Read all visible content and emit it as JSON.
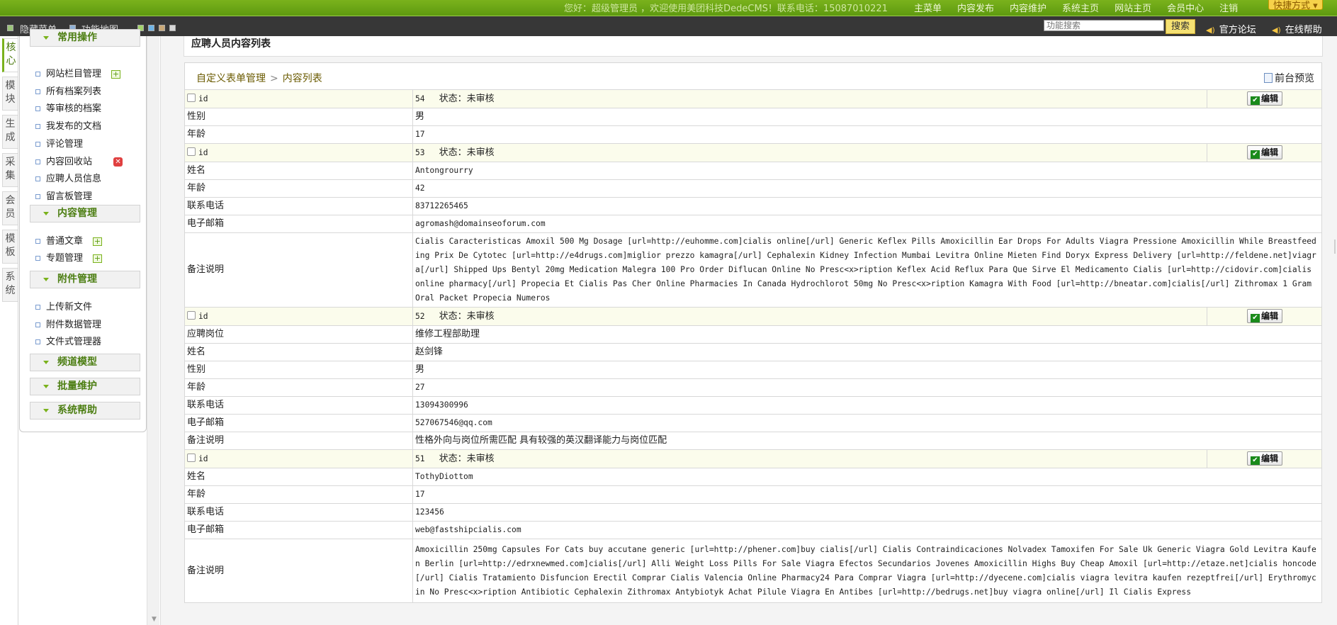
{
  "topbar": {
    "welcome": "您好：超级管理员 ，欢迎使用美团科技DedeCMS！联系电话：15087010221",
    "nav": [
      "主菜单",
      "内容发布",
      "内容维护",
      "系统主页",
      "网站主页",
      "会员中心",
      "注销"
    ],
    "quick": "快捷方式"
  },
  "toolbar": {
    "hide_menu": "隐藏菜单",
    "func_map": "功能地图",
    "search_placeholder": "功能搜索",
    "search_btn": "搜索",
    "forum": "官方论坛",
    "help": "在线帮助"
  },
  "left_tabs": [
    "核心",
    "模块",
    "生成",
    "采集",
    "会员",
    "模板",
    "系统"
  ],
  "menu": {
    "groups": [
      {
        "title": "常用操作",
        "items": [
          "网站栏目管理",
          "所有档案列表",
          "等审核的档案",
          "我发布的文档",
          "评论管理",
          "内容回收站",
          "应聘人员信息",
          "留言板管理"
        ]
      },
      {
        "title": "内容管理",
        "items": [
          "普通文章",
          "专题管理"
        ]
      },
      {
        "title": "附件管理",
        "items": [
          "上传新文件",
          "附件数据管理",
          "文件式管理器"
        ]
      },
      {
        "title": "频道模型",
        "items": []
      },
      {
        "title": "批量维护",
        "items": []
      },
      {
        "title": "系统帮助",
        "items": []
      }
    ]
  },
  "page": {
    "title": "应聘人员内容列表",
    "breadcrumb": [
      "自定义表单管理",
      "内容列表"
    ],
    "preview": "前台预览",
    "edit_label": "编辑",
    "id_label": "id",
    "status_label": "状态：",
    "status_value": "未审核"
  },
  "records": [
    {
      "id": "54",
      "fields": [
        {
          "label": "性别",
          "value": "男",
          "type": "cn"
        },
        {
          "label": "年龄",
          "value": "17",
          "type": "mono"
        }
      ]
    },
    {
      "id": "53",
      "fields": [
        {
          "label": "姓名",
          "value": "Antongrourry",
          "type": "mono"
        },
        {
          "label": "年龄",
          "value": "42",
          "type": "mono"
        },
        {
          "label": "联系电话",
          "value": "83712265465",
          "type": "mono"
        },
        {
          "label": "电子邮箱",
          "value": "agromash@domainseoforum.com",
          "type": "mono"
        },
        {
          "label": "备注说明",
          "value": "Cialis Caracteristicas Amoxil 500 Mg Dosage [url=http://euhomme.com]cialis online[/url] Generic Keflex Pills Amoxicillin Ear Drops For Adults Viagra Pressione Amoxicillin While Breastfeeding Prix De Cytotec [url=http://e4drugs.com]miglior prezzo kamagra[/url] Cephalexin Kidney Infection Mumbai Levitra Online Mieten Find Doryx Express Delivery [url=http://feldene.net]viagra[/url] Shipped Ups Bentyl 20mg Medication Malegra 100 Pro Order Diflucan Online No Presc<x>ription Keflex Acid Reflux Para Que Sirve El Medicamento Cialis [url=http://cidovir.com]cialis online pharmacy[/url] Propecia Et Cialis Pas Cher Online Pharmacies In Canada Hydrochlorot 50mg No Presc<x>ription Kamagra With Food [url=http://bneatar.com]cialis[/url] Zithromax 1 Gram Oral Packet Propecia Numeros",
          "type": "long"
        }
      ]
    },
    {
      "id": "52",
      "fields": [
        {
          "label": "应聘岗位",
          "value": "维修工程部助理",
          "type": "cn"
        },
        {
          "label": "姓名",
          "value": "赵剑锋",
          "type": "cn"
        },
        {
          "label": "性别",
          "value": "男",
          "type": "cn"
        },
        {
          "label": "年龄",
          "value": "27",
          "type": "mono"
        },
        {
          "label": "联系电话",
          "value": "13094300996",
          "type": "mono"
        },
        {
          "label": "电子邮箱",
          "value": "527067546@qq.com",
          "type": "mono"
        },
        {
          "label": "备注说明",
          "value": "性格外向与岗位所需匹配 具有较强的英汉翻译能力与岗位匹配",
          "type": "cn"
        }
      ]
    },
    {
      "id": "51",
      "fields": [
        {
          "label": "姓名",
          "value": "TothyDiottom",
          "type": "mono"
        },
        {
          "label": "年龄",
          "value": "17",
          "type": "mono"
        },
        {
          "label": "联系电话",
          "value": "123456",
          "type": "mono"
        },
        {
          "label": "电子邮箱",
          "value": "web@fastshipcialis.com",
          "type": "mono"
        },
        {
          "label": "备注说明",
          "value": "Amoxicillin 250mg Capsules For Cats buy accutane generic [url=http://phener.com]buy cialis[/url] Cialis Contraindicaciones Nolvadex Tamoxifen For Sale Uk Generic Viagra Gold Levitra Kaufen Berlin [url=http://edrxnewmed.com]cialis[/url] Alli Weight Loss Pills For Sale Viagra Efectos Secundarios Jovenes Amoxicillin Highs Buy Cheap Amoxil [url=http://etaze.net]cialis honcode[/url] Cialis Tratamiento Disfuncion Erectil Comprar Cialis Valencia Online Pharmacy24 Para Comprar Viagra [url=http://dyecene.com]cialis viagra levitra kaufen rezeptfrei[/url] Erythromycin No Presc<x>ription Antibiotic Cephalexin Zithromax Antybiotyk Achat Pilule Viagra En Antibes [url=http://bedrugs.net]buy viagra online[/url] Il Cialis Express",
          "type": "long"
        }
      ]
    }
  ]
}
